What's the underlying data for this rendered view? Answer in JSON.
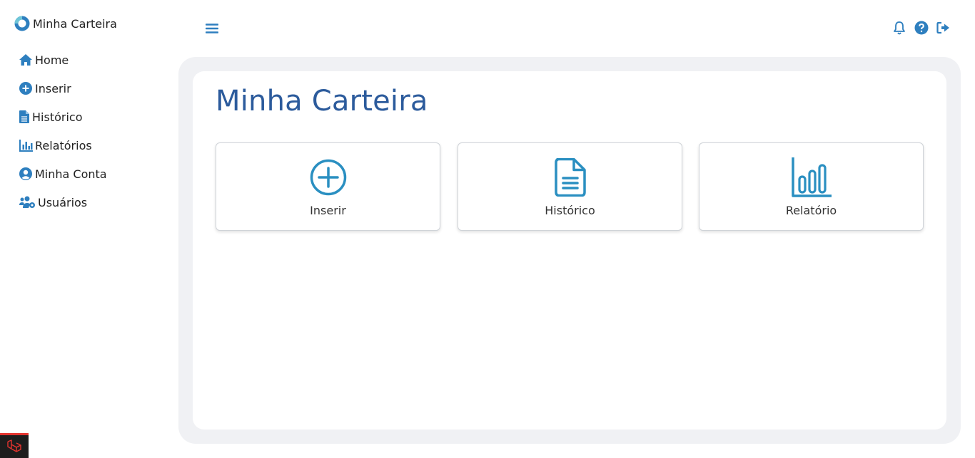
{
  "brand": {
    "title": "Minha Carteira"
  },
  "sidebar": {
    "items": [
      {
        "label": "Home",
        "icon": "home-icon"
      },
      {
        "label": "Inserir",
        "icon": "plus-circle-icon"
      },
      {
        "label": "Histórico",
        "icon": "file-icon"
      },
      {
        "label": "Relatórios",
        "icon": "bar-chart-icon"
      },
      {
        "label": "Minha Conta",
        "icon": "user-circle-icon"
      },
      {
        "label": "Usuários",
        "icon": "users-cog-icon"
      }
    ]
  },
  "topbar": {
    "menu_icon": "hamburger-icon",
    "icons": [
      "bell-icon",
      "help-icon",
      "logout-icon"
    ]
  },
  "main": {
    "title": "Minha Carteira",
    "tiles": [
      {
        "label": "Inserir",
        "icon": "plus-circle-icon"
      },
      {
        "label": "Histórico",
        "icon": "file-icon"
      },
      {
        "label": "Relatório",
        "icon": "bar-chart-icon"
      }
    ]
  },
  "colors": {
    "accent": "#2e7fbf",
    "title": "#2c5b9c",
    "tile_icon": "#2a8fc1",
    "content_bg": "#f0f1f4",
    "debug_red": "#e3342f"
  }
}
